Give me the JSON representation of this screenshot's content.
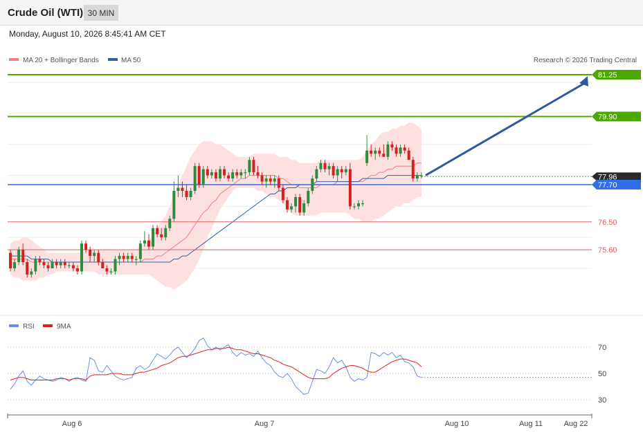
{
  "header": {
    "title": "Crude Oil (WTI)",
    "timeframe": "30 MIN"
  },
  "datetime": "Monday, August 10, 2026 8:45:41 AM CET",
  "colors": {
    "band_fill": "#fde0e0",
    "ma20": "#f08080",
    "ma50": "#3060a0",
    "bull": "#2e8b3e",
    "bear": "#d42020",
    "resistance": "#4ca800",
    "pivot": "#2e6ee8",
    "support": "#e06060",
    "rsi": "#6b8ee0",
    "rsi_ma": "#e02020",
    "arrow": "#2e5a9a"
  },
  "chart_data": [
    {
      "type": "candlestick",
      "title": "",
      "legend": [
        "MA 20 + Bollinger Bands",
        "MA 50"
      ],
      "legend_placement": "top-left",
      "source_note": "Research © 2026 Trading Central",
      "ylim": [
        74.5,
        81.7
      ],
      "grid": true,
      "x_ticks": [
        "Aug 6",
        "Aug 7",
        "Aug 10",
        "Aug 11",
        "Aug 22"
      ],
      "levels": [
        {
          "value": 81.25,
          "label": "81.25",
          "kind": "resistance"
        },
        {
          "value": 79.9,
          "label": "79.90",
          "kind": "resistance"
        },
        {
          "value": 77.96,
          "label": "77.96",
          "kind": "last"
        },
        {
          "value": 77.7,
          "label": "77.70",
          "kind": "pivot"
        },
        {
          "value": 76.5,
          "label": "76.50",
          "kind": "support"
        },
        {
          "value": 75.6,
          "label": "75.60",
          "kind": "support"
        }
      ],
      "target": 81.25,
      "candles": [
        [
          75.5,
          75.6,
          74.9,
          75.0
        ],
        [
          75.0,
          75.3,
          74.9,
          75.2
        ],
        [
          75.2,
          75.7,
          75.1,
          75.6
        ],
        [
          75.6,
          75.8,
          75.1,
          75.2
        ],
        [
          75.2,
          75.3,
          74.7,
          74.8
        ],
        [
          74.8,
          75.0,
          74.7,
          74.9
        ],
        [
          74.9,
          75.4,
          74.8,
          75.3
        ],
        [
          75.3,
          75.4,
          75.1,
          75.2
        ],
        [
          75.2,
          75.3,
          75.0,
          75.1
        ],
        [
          75.1,
          75.2,
          74.9,
          75.0
        ],
        [
          75.0,
          75.3,
          75.0,
          75.2
        ],
        [
          75.2,
          75.3,
          75.0,
          75.1
        ],
        [
          75.1,
          75.3,
          75.0,
          75.2
        ],
        [
          75.2,
          75.3,
          75.0,
          75.1
        ],
        [
          75.1,
          75.2,
          75.0,
          75.1
        ],
        [
          75.1,
          75.2,
          74.9,
          75.0
        ],
        [
          75.0,
          75.1,
          74.8,
          74.9
        ],
        [
          74.9,
          75.9,
          74.8,
          75.8
        ],
        [
          75.8,
          75.9,
          75.5,
          75.6
        ],
        [
          75.6,
          75.7,
          75.2,
          75.4
        ],
        [
          75.4,
          75.6,
          75.2,
          75.5
        ],
        [
          75.5,
          75.6,
          75.1,
          75.2
        ],
        [
          75.2,
          75.3,
          75.0,
          75.0
        ],
        [
          75.0,
          75.1,
          74.8,
          74.9
        ],
        [
          74.9,
          75.0,
          74.8,
          74.9
        ],
        [
          74.9,
          75.4,
          74.8,
          75.3
        ],
        [
          75.3,
          75.5,
          75.1,
          75.4
        ],
        [
          75.4,
          75.5,
          75.2,
          75.3
        ],
        [
          75.3,
          75.5,
          75.2,
          75.4
        ],
        [
          75.4,
          75.5,
          75.2,
          75.3
        ],
        [
          75.3,
          75.4,
          75.1,
          75.3
        ],
        [
          75.3,
          75.9,
          75.2,
          75.8
        ],
        [
          75.8,
          76.2,
          75.7,
          75.9
        ],
        [
          75.9,
          76.1,
          75.6,
          75.7
        ],
        [
          75.7,
          76.4,
          75.6,
          76.3
        ],
        [
          76.3,
          76.4,
          76.0,
          76.1
        ],
        [
          76.1,
          76.3,
          75.9,
          76.0
        ],
        [
          76.0,
          76.4,
          75.9,
          76.3
        ],
        [
          76.3,
          76.7,
          76.2,
          76.6
        ],
        [
          76.6,
          77.8,
          76.5,
          77.5
        ],
        [
          77.5,
          78.0,
          77.3,
          77.6
        ],
        [
          77.6,
          77.8,
          77.3,
          77.5
        ],
        [
          77.5,
          77.7,
          77.2,
          77.3
        ],
        [
          77.3,
          77.6,
          77.2,
          77.5
        ],
        [
          77.5,
          78.4,
          77.4,
          78.3
        ],
        [
          78.3,
          78.4,
          77.6,
          77.7
        ],
        [
          77.7,
          78.3,
          77.6,
          78.2
        ],
        [
          78.2,
          78.3,
          77.9,
          78.0
        ],
        [
          78.0,
          78.2,
          77.9,
          78.1
        ],
        [
          78.1,
          78.2,
          77.8,
          77.9
        ],
        [
          77.9,
          78.3,
          77.8,
          78.2
        ],
        [
          78.2,
          78.3,
          77.9,
          78.0
        ],
        [
          78.0,
          78.1,
          77.8,
          77.9
        ],
        [
          77.9,
          78.2,
          77.8,
          78.1
        ],
        [
          78.1,
          78.2,
          77.9,
          78.0
        ],
        [
          78.0,
          78.2,
          77.9,
          78.1
        ],
        [
          78.1,
          78.2,
          77.9,
          78.1
        ],
        [
          78.1,
          78.6,
          78.0,
          78.5
        ],
        [
          78.5,
          78.6,
          78.0,
          78.1
        ],
        [
          78.1,
          78.3,
          77.9,
          78.0
        ],
        [
          78.0,
          78.1,
          77.7,
          77.8
        ],
        [
          77.8,
          78.0,
          77.6,
          77.9
        ],
        [
          77.9,
          78.0,
          77.7,
          77.8
        ],
        [
          77.8,
          78.0,
          77.6,
          77.9
        ],
        [
          77.9,
          78.0,
          77.5,
          77.6
        ],
        [
          77.6,
          77.7,
          77.1,
          77.2
        ],
        [
          77.2,
          77.3,
          76.8,
          76.9
        ],
        [
          76.9,
          77.1,
          76.8,
          77.0
        ],
        [
          77.0,
          77.4,
          76.8,
          77.3
        ],
        [
          77.3,
          77.4,
          76.7,
          76.8
        ],
        [
          76.8,
          77.2,
          76.7,
          77.1
        ],
        [
          77.1,
          77.6,
          77.0,
          77.5
        ],
        [
          77.5,
          78.0,
          77.4,
          77.9
        ],
        [
          77.9,
          78.3,
          77.8,
          78.2
        ],
        [
          78.2,
          78.5,
          78.1,
          78.4
        ],
        [
          78.4,
          78.5,
          78.1,
          78.2
        ],
        [
          78.2,
          78.4,
          78.0,
          78.3
        ],
        [
          78.3,
          78.4,
          77.9,
          78.0
        ],
        [
          78.0,
          78.3,
          77.8,
          78.2
        ],
        [
          78.2,
          78.3,
          77.9,
          78.1
        ],
        [
          78.1,
          78.3,
          78.0,
          78.2
        ],
        [
          78.2,
          78.4,
          76.9,
          77.0
        ],
        [
          77.0,
          77.1,
          76.9,
          77.0
        ],
        [
          77.0,
          77.2,
          76.9,
          77.1
        ],
        [
          77.1,
          77.2,
          77.0,
          77.1
        ],
        [
          78.4,
          79.3,
          78.3,
          78.8
        ],
        [
          78.8,
          79.0,
          78.6,
          78.7
        ],
        [
          78.7,
          78.9,
          78.5,
          78.8
        ],
        [
          78.8,
          78.9,
          78.6,
          78.7
        ],
        [
          78.7,
          79.0,
          78.6,
          78.6
        ],
        [
          78.6,
          79.1,
          78.5,
          79.0
        ],
        [
          79.0,
          79.1,
          78.8,
          78.9
        ],
        [
          78.9,
          79.0,
          78.6,
          78.7
        ],
        [
          78.7,
          79.0,
          78.6,
          78.9
        ],
        [
          78.9,
          79.0,
          78.7,
          78.8
        ],
        [
          78.8,
          78.9,
          78.5,
          78.5
        ],
        [
          78.5,
          78.6,
          77.8,
          77.9
        ],
        [
          77.9,
          78.1,
          77.8,
          78.0
        ],
        [
          78.0,
          78.1,
          77.9,
          78.0
        ]
      ],
      "ma20": [
        75.3,
        75.3,
        75.3,
        75.3,
        75.3,
        75.2,
        75.2,
        75.2,
        75.2,
        75.2,
        75.2,
        75.2,
        75.2,
        75.2,
        75.2,
        75.2,
        75.2,
        75.2,
        75.2,
        75.2,
        75.2,
        75.2,
        75.2,
        75.2,
        75.2,
        75.2,
        75.2,
        75.2,
        75.2,
        75.2,
        75.2,
        75.2,
        75.3,
        75.3,
        75.3,
        75.4,
        75.4,
        75.5,
        75.6,
        75.7,
        75.8,
        75.9,
        76.0,
        76.2,
        76.4,
        76.6,
        76.8,
        76.9,
        77.1,
        77.2,
        77.4,
        77.5,
        77.6,
        77.7,
        77.8,
        77.9,
        77.9,
        78.0,
        78.0,
        78.0,
        78.0,
        78.0,
        78.0,
        78.0,
        77.9,
        77.9,
        77.8,
        77.7,
        77.7,
        77.6,
        77.6,
        77.6,
        77.6,
        77.6,
        77.7,
        77.7,
        77.7,
        77.7,
        77.8,
        77.8,
        77.8,
        77.8,
        77.8,
        77.8,
        77.8,
        77.9,
        78.0,
        78.0,
        78.1,
        78.1,
        78.2,
        78.2,
        78.3,
        78.3,
        78.3,
        78.3,
        78.3,
        78.4,
        78.4
      ],
      "ma50": [
        75.4,
        75.4,
        75.4,
        75.4,
        75.4,
        75.3,
        75.3,
        75.3,
        75.3,
        75.3,
        75.2,
        75.2,
        75.2,
        75.2,
        75.2,
        75.2,
        75.2,
        75.2,
        75.2,
        75.2,
        75.2,
        75.2,
        75.2,
        75.2,
        75.2,
        75.2,
        75.2,
        75.2,
        75.2,
        75.2,
        75.2,
        75.2,
        75.2,
        75.2,
        75.2,
        75.2,
        75.2,
        75.2,
        75.2,
        75.3,
        75.3,
        75.4,
        75.4,
        75.5,
        75.6,
        75.7,
        75.8,
        75.9,
        76.0,
        76.1,
        76.2,
        76.3,
        76.4,
        76.5,
        76.6,
        76.7,
        76.8,
        76.9,
        77.0,
        77.1,
        77.2,
        77.3,
        77.4,
        77.4,
        77.5,
        77.5,
        77.6,
        77.6,
        77.6,
        77.7,
        77.7,
        77.7,
        77.7,
        77.8,
        77.8,
        77.8,
        77.8,
        77.8,
        77.8,
        77.8,
        77.8,
        77.8,
        77.8,
        77.8,
        77.9,
        77.9,
        77.9,
        77.9,
        77.9,
        77.9,
        78.0,
        78.0,
        78.0,
        78.0,
        78.0,
        78.0,
        78.0,
        78.0,
        78.0
      ],
      "bb_upper": [
        75.8,
        75.9,
        75.9,
        76.0,
        76.0,
        75.9,
        75.8,
        75.7,
        75.6,
        75.5,
        75.5,
        75.5,
        75.5,
        75.5,
        75.5,
        75.5,
        75.5,
        75.5,
        75.6,
        75.6,
        75.6,
        75.6,
        75.6,
        75.6,
        75.6,
        75.6,
        75.6,
        75.6,
        75.6,
        75.6,
        75.6,
        75.7,
        75.8,
        75.9,
        76.1,
        76.3,
        76.5,
        76.7,
        77.0,
        77.4,
        77.7,
        78.0,
        78.3,
        78.6,
        78.8,
        79.0,
        79.1,
        79.1,
        79.1,
        79.0,
        79.0,
        78.9,
        78.8,
        78.7,
        78.6,
        78.6,
        78.6,
        78.6,
        78.7,
        78.7,
        78.7,
        78.7,
        78.7,
        78.7,
        78.6,
        78.6,
        78.6,
        78.5,
        78.5,
        78.4,
        78.4,
        78.4,
        78.4,
        78.4,
        78.5,
        78.5,
        78.5,
        78.5,
        78.5,
        78.5,
        78.5,
        78.5,
        78.5,
        78.5,
        78.6,
        78.8,
        79.0,
        79.1,
        79.3,
        79.4,
        79.4,
        79.5,
        79.5,
        79.6,
        79.6,
        79.7,
        79.7,
        79.6,
        79.5
      ],
      "bb_lower": [
        74.8,
        74.7,
        74.7,
        74.6,
        74.6,
        74.6,
        74.6,
        74.7,
        74.7,
        74.8,
        74.8,
        74.9,
        74.9,
        74.9,
        74.9,
        74.9,
        74.9,
        74.9,
        74.9,
        74.9,
        74.9,
        74.8,
        74.8,
        74.8,
        74.8,
        74.8,
        74.8,
        74.8,
        74.8,
        74.8,
        74.8,
        74.8,
        74.8,
        74.8,
        74.7,
        74.6,
        74.5,
        74.4,
        74.4,
        74.3,
        74.4,
        74.5,
        74.6,
        74.8,
        75.0,
        75.3,
        75.6,
        76.0,
        76.3,
        76.6,
        76.9,
        77.1,
        77.3,
        77.5,
        77.6,
        77.6,
        77.6,
        77.6,
        77.6,
        77.5,
        77.5,
        77.4,
        77.3,
        77.3,
        77.2,
        77.1,
        76.9,
        76.8,
        76.7,
        76.7,
        76.7,
        76.7,
        76.7,
        76.7,
        76.8,
        76.8,
        76.8,
        76.8,
        76.8,
        76.8,
        76.8,
        76.7,
        76.6,
        76.6,
        76.5,
        76.5,
        76.5,
        76.6,
        76.6,
        76.7,
        76.8,
        76.9,
        77.0,
        77.0,
        77.1,
        77.1,
        77.2,
        77.3,
        77.3
      ]
    },
    {
      "type": "line",
      "title": "",
      "legend": [
        "RSI",
        "9MA"
      ],
      "legend_placement": "top-left",
      "ylim": [
        20,
        80
      ],
      "y_ticks": [
        70,
        50,
        30
      ],
      "current_value": 47,
      "series": [
        {
          "name": "RSI",
          "values": [
            38,
            42,
            48,
            52,
            44,
            41,
            45,
            48,
            46,
            45,
            44,
            45,
            47,
            46,
            44,
            46,
            47,
            45,
            44,
            62,
            60,
            52,
            51,
            56,
            52,
            48,
            46,
            45,
            46,
            47,
            54,
            56,
            53,
            55,
            60,
            65,
            63,
            61,
            64,
            68,
            70,
            66,
            62,
            65,
            69,
            75,
            77,
            71,
            68,
            70,
            68,
            70,
            72,
            66,
            63,
            66,
            64,
            65,
            63,
            67,
            62,
            58,
            56,
            51,
            48,
            47,
            50,
            46,
            40,
            37,
            34,
            35,
            44,
            53,
            52,
            50,
            55,
            62,
            58,
            60,
            55,
            47,
            44,
            46,
            45,
            47,
            66,
            65,
            63,
            66,
            64,
            66,
            62,
            64,
            59,
            58,
            55,
            48,
            47
          ]
        },
        {
          "name": "9MA",
          "values": [
            45,
            46,
            47,
            47,
            46,
            45,
            45,
            45,
            45,
            45,
            45,
            46,
            46,
            46,
            45,
            46,
            46,
            46,
            45,
            48,
            49,
            49,
            49,
            49,
            50,
            50,
            50,
            49,
            49,
            49,
            50,
            51,
            51,
            52,
            53,
            54,
            56,
            57,
            58,
            60,
            62,
            63,
            63,
            64,
            65,
            66,
            67,
            68,
            68,
            69,
            69,
            69,
            70,
            69,
            68,
            68,
            67,
            66,
            65,
            65,
            64,
            63,
            62,
            60,
            59,
            57,
            56,
            55,
            53,
            51,
            49,
            47,
            46,
            46,
            46,
            46,
            47,
            50,
            52,
            54,
            55,
            56,
            56,
            55,
            54,
            52,
            51,
            51,
            53,
            55,
            57,
            59,
            60,
            61,
            61,
            60,
            59,
            58,
            55
          ]
        }
      ]
    }
  ]
}
